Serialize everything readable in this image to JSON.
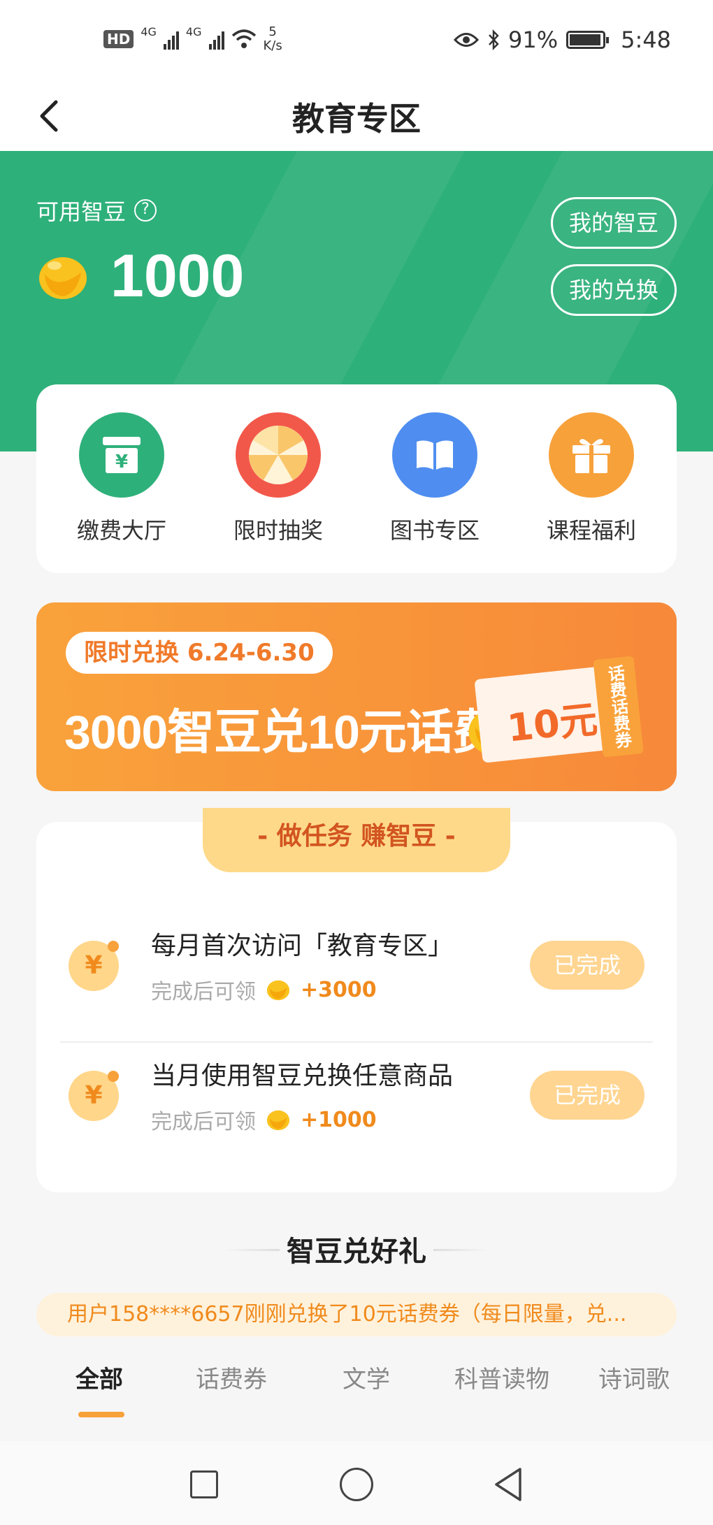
{
  "status_bar": {
    "hd": "HD",
    "net1": "4G",
    "net2": "4G",
    "speed_value": "5",
    "speed_unit": "K/s",
    "battery": "91%",
    "time": "5:48"
  },
  "navbar": {
    "title": "教育专区"
  },
  "beans": {
    "label": "可用智豆",
    "help": "?",
    "value": "1000",
    "my_beans": "我的智豆",
    "my_exchange": "我的兑换"
  },
  "quick_items": [
    {
      "label": "缴费大厅",
      "color": "#2eb07a"
    },
    {
      "label": "限时抽奖",
      "color": "#f2584a"
    },
    {
      "label": "图书专区",
      "color": "#4f8ef0"
    },
    {
      "label": "课程福利",
      "color": "#f7a13a"
    }
  ],
  "banner": {
    "tag": "限时兑换 6.24-6.30",
    "main": "3000智豆兑10元话费",
    "coupon_value": "10元",
    "coupon_side": "话费话费券"
  },
  "tasks": {
    "header": "- 做任务 赚智豆 -",
    "items": [
      {
        "title": "每月首次访问「教育专区」",
        "sub": "完成后可领",
        "reward": "+3000",
        "button": "已完成"
      },
      {
        "title": "当月使用智豆兑换任意商品",
        "sub": "完成后可领",
        "reward": "+1000",
        "button": "已完成"
      }
    ]
  },
  "gifts": {
    "title": "智豆兑好礼",
    "ticker": "用户158****6657刚刚兑换了10元话费券（每日限量，兑..."
  },
  "tabs": [
    "全部",
    "话费券",
    "文学",
    "科普读物",
    "诗词歌"
  ],
  "colors": {
    "primary": "#2eb07a",
    "accent": "#f7a13a",
    "banner": "#f9a23b"
  }
}
